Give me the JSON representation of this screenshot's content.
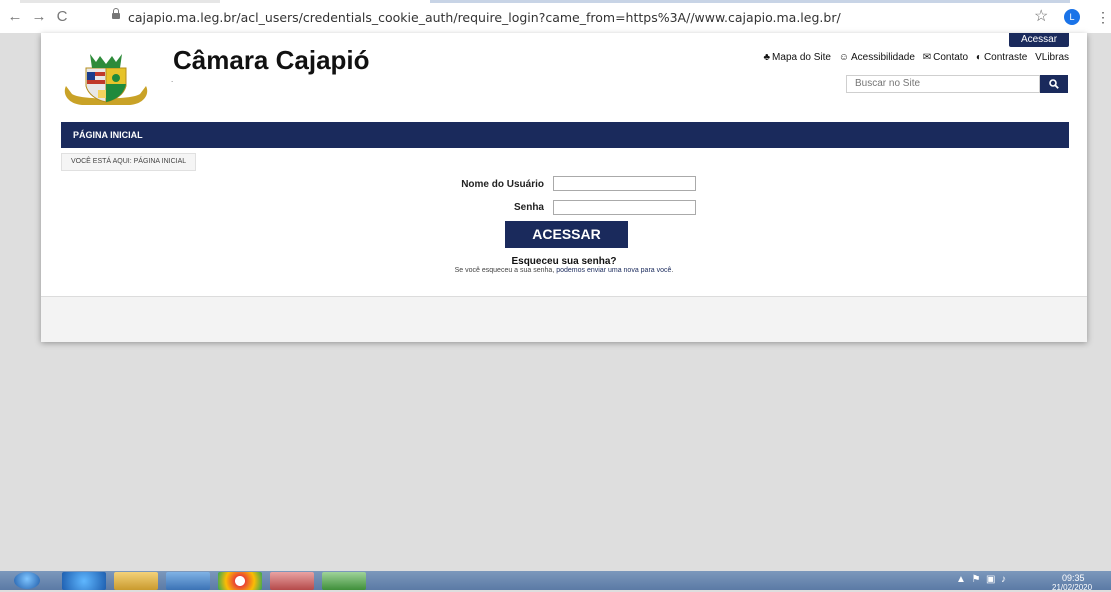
{
  "browser": {
    "url": "cajapio.ma.leg.br/acl_users/credentials_cookie_auth/require_login?came_from=https%3A//www.cajapio.ma.leg.br/",
    "back_glyph": "←",
    "forward_glyph": "→",
    "reload_glyph": "C",
    "star_glyph": "☆",
    "avatar_initial": "L",
    "menu_glyph": "⋮"
  },
  "header": {
    "site_title": "Câmara Cajapió",
    "site_subtitle": ".",
    "acessar_label": "Acessar",
    "top_links": [
      {
        "icon": "sitemap-icon",
        "label": "Mapa do Site"
      },
      {
        "icon": "accessibility-icon",
        "label": "Acessibilidade"
      },
      {
        "icon": "envelope-icon",
        "label": "Contato"
      },
      {
        "icon": "contrast-icon",
        "label": "Contraste"
      },
      {
        "icon": "",
        "label": "VLibras"
      }
    ],
    "search_placeholder": "Buscar no Site"
  },
  "nav": {
    "home_label": "PÁGINA INICIAL"
  },
  "breadcrumb": {
    "text": "VOCÊ ESTÁ AQUI: PÁGINA INICIAL"
  },
  "login": {
    "username_label": "Nome do Usuário",
    "password_label": "Senha",
    "submit_label": "ACESSAR",
    "forgot_title": "Esqueceu sua senha?",
    "forgot_text_prefix": "Se você esqueceu a sua senha, ",
    "forgot_link": "podemos enviar uma nova para você",
    "forgot_text_suffix": "."
  },
  "taskbar": {
    "clock_time": "09:35",
    "clock_date": "21/02/2020"
  },
  "colors": {
    "brand_navy": "#1a2a5c",
    "page_background": "#dedede"
  }
}
